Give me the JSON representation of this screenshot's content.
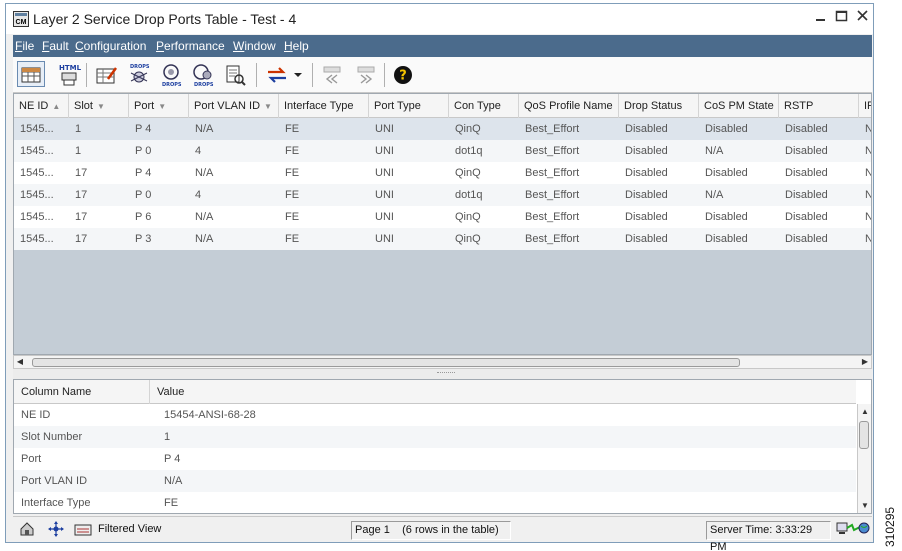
{
  "window": {
    "title": "Layer 2 Service Drop Ports Table - Test - 4",
    "icon_text": "CM"
  },
  "menu": [
    {
      "label": "File",
      "mnemonic": "F",
      "rest": "ile"
    },
    {
      "label": "Fault",
      "mnemonic": "F",
      "rest": "ault"
    },
    {
      "label": "Configuration",
      "mnemonic": "C",
      "rest": "onfiguration"
    },
    {
      "label": "Performance",
      "mnemonic": "P",
      "rest": "erformance"
    },
    {
      "label": "Window",
      "mnemonic": "W",
      "rest": "indow"
    },
    {
      "label": "Help",
      "mnemonic": "H",
      "rest": "elp"
    }
  ],
  "toolbar": {
    "html_label": "HTML",
    "drops_label": "DROPS",
    "help_label": "?"
  },
  "table": {
    "columns": [
      "NE ID",
      "Slot",
      "Port",
      "Port VLAN ID",
      "Interface Type",
      "Port Type",
      "Con Type",
      "QoS Profile Name",
      "Drop Status",
      "CoS PM State",
      "RSTP",
      "IP"
    ],
    "sort_ascending_glyph": "▲",
    "sort_descending_glyph": "▼",
    "rows": [
      [
        "1545...",
        "1",
        "P  4",
        "N/A",
        "FE",
        "UNI",
        "QinQ",
        "Best_Effort",
        "Disabled",
        "Disabled",
        "Disabled",
        "N"
      ],
      [
        "1545...",
        "1",
        "P  0",
        "4",
        "FE",
        "UNI",
        "dot1q",
        "Best_Effort",
        "Disabled",
        "N/A",
        "Disabled",
        "N"
      ],
      [
        "1545...",
        "17",
        "P  4",
        "N/A",
        "FE",
        "UNI",
        "QinQ",
        "Best_Effort",
        "Disabled",
        "Disabled",
        "Disabled",
        "N"
      ],
      [
        "1545...",
        "17",
        "P  0",
        "4",
        "FE",
        "UNI",
        "dot1q",
        "Best_Effort",
        "Disabled",
        "N/A",
        "Disabled",
        "N"
      ],
      [
        "1545...",
        "17",
        "P  6",
        "N/A",
        "FE",
        "UNI",
        "QinQ",
        "Best_Effort",
        "Disabled",
        "Disabled",
        "Disabled",
        "N"
      ],
      [
        "1545...",
        "17",
        "P  3",
        "N/A",
        "FE",
        "UNI",
        "QinQ",
        "Best_Effort",
        "Disabled",
        "Disabled",
        "Disabled",
        "N"
      ]
    ]
  },
  "details": {
    "col_name": "Column Name",
    "col_value": "Value",
    "rows": [
      {
        "name": "NE ID",
        "value": "15454-ANSI-68-28"
      },
      {
        "name": "Slot Number",
        "value": "1"
      },
      {
        "name": "Port",
        "value": "P  4"
      },
      {
        "name": "Port VLAN ID",
        "value": "N/A"
      },
      {
        "name": "Interface Type",
        "value": "FE"
      }
    ]
  },
  "status": {
    "filter": "Filtered View",
    "page": "Page 1",
    "rows_text": "(6  rows in the table)",
    "server_time": "Server Time: 3:33:29 PM"
  },
  "figure_id": "310295",
  "colors": {
    "menubar": "#4b6b8c",
    "selected_row": "#dde4ec",
    "empty_table": "#c4cdd6"
  }
}
